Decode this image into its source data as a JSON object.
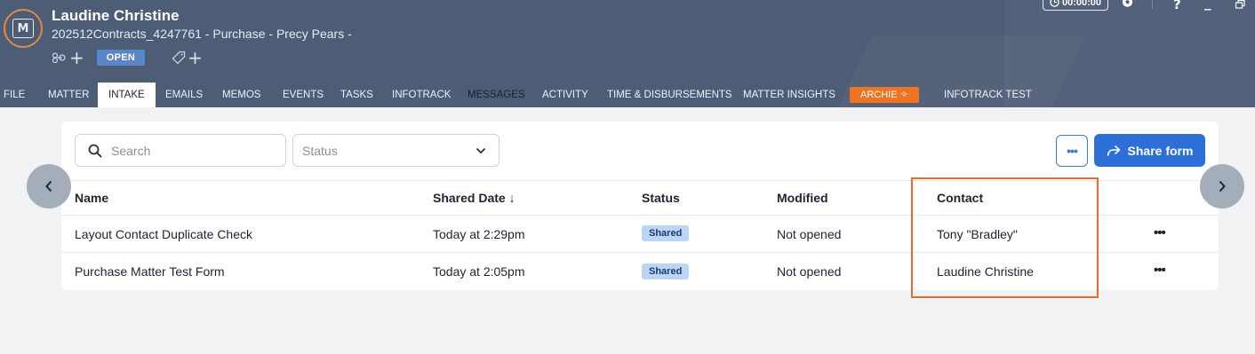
{
  "header": {
    "logo_letter": "M",
    "client_name": "Laudine Christine",
    "matter_line": "202512Contracts_4247761 - Purchase - Precy Pears -",
    "status_badge": "OPEN",
    "timer": "00:00:00",
    "help": "?",
    "minimize": "_"
  },
  "tabs": [
    {
      "label": "FILE"
    },
    {
      "label": "MATTER"
    },
    {
      "label": "INTAKE"
    },
    {
      "label": "EMAILS"
    },
    {
      "label": "MEMOS"
    },
    {
      "label": "EVENTS"
    },
    {
      "label": "TASKS"
    },
    {
      "label": "INFOTRACK"
    },
    {
      "label": "MESSAGES"
    },
    {
      "label": "ACTIVITY"
    },
    {
      "label": "TIME & DISBURSEMENTS"
    },
    {
      "label": "MATTER INSIGHTS"
    },
    {
      "label": "ARCHIE ✧"
    },
    {
      "label": "INFOTRACK TEST"
    }
  ],
  "toolbar": {
    "search_placeholder": "Search",
    "status_placeholder": "Status",
    "share_label": "Share form"
  },
  "table": {
    "columns": [
      "Name",
      "Shared Date ↓",
      "Status",
      "Modified",
      "Contact"
    ],
    "rows": [
      {
        "name": "Layout Contact Duplicate Check",
        "shared_date": "Today at 2:29pm",
        "status": "Shared",
        "modified": "Not opened",
        "contact": "Tony \"Bradley\""
      },
      {
        "name": "Purchase Matter Test Form",
        "shared_date": "Today at 2:05pm",
        "status": "Shared",
        "modified": "Not opened",
        "contact": "Laudine Christine"
      }
    ]
  },
  "colors": {
    "header_bg": "#4e5d76",
    "accent_orange": "#ee7421",
    "primary_blue": "#2d6fd8",
    "highlight": "#ea6b27"
  },
  "icons": [
    "matter-logo-icon",
    "link-icon",
    "tag-icon",
    "clock-icon",
    "gear-icon",
    "search-icon",
    "chevron-down-icon",
    "share-icon",
    "chevron-left-icon",
    "chevron-right-icon"
  ]
}
